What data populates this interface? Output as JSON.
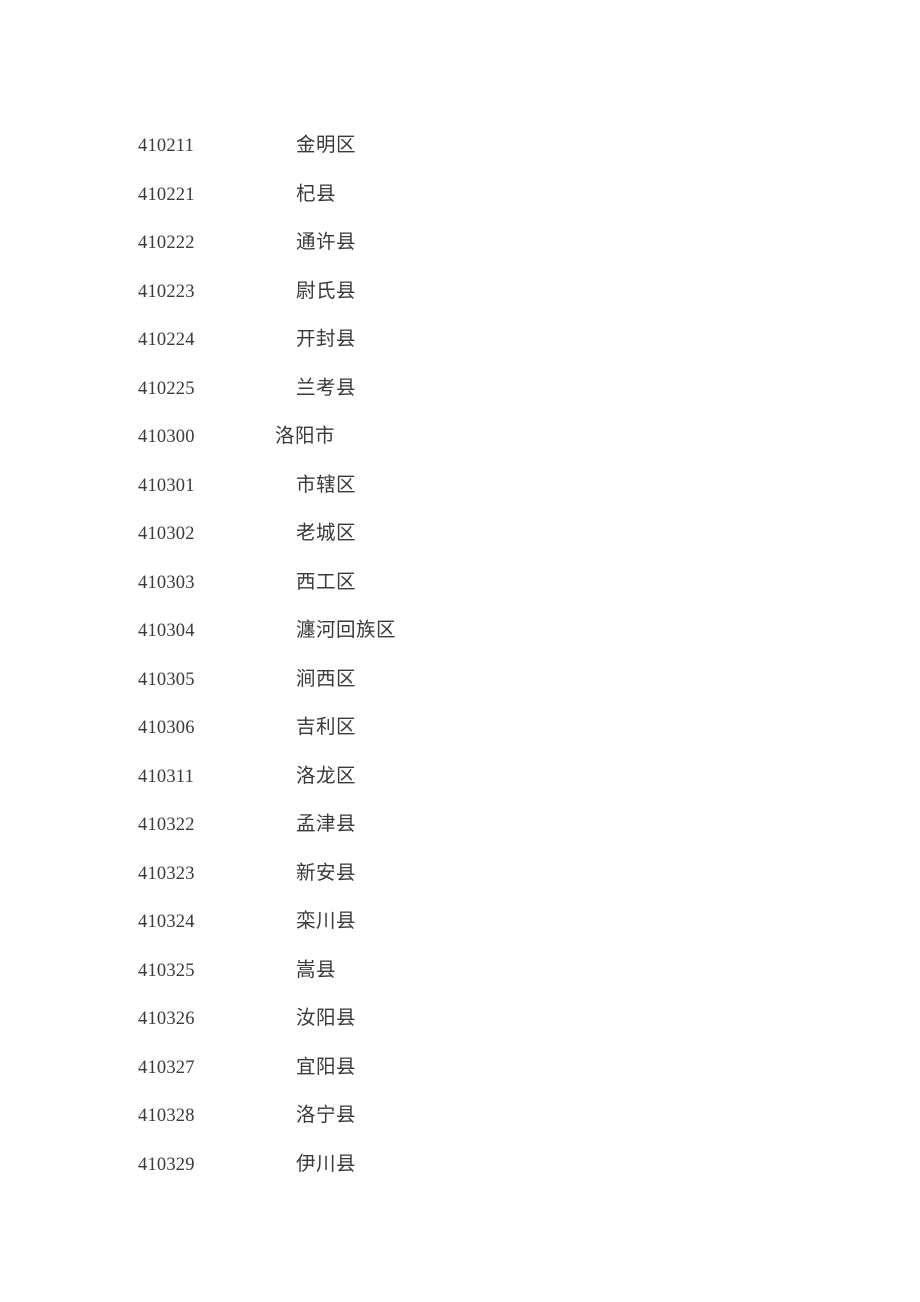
{
  "document": {
    "background_color": "#ffffff",
    "text_color": "#3a3a3a"
  },
  "code_list": {
    "rows": [
      {
        "code": "410211",
        "name": "金明区",
        "level": "county"
      },
      {
        "code": "410221",
        "name": "杞县",
        "level": "county"
      },
      {
        "code": "410222",
        "name": "通许县",
        "level": "county"
      },
      {
        "code": "410223",
        "name": "尉氏县",
        "level": "county"
      },
      {
        "code": "410224",
        "name": "开封县",
        "level": "county"
      },
      {
        "code": "410225",
        "name": "兰考县",
        "level": "county"
      },
      {
        "code": "410300",
        "name": "洛阳市",
        "level": "city"
      },
      {
        "code": "410301",
        "name": "市辖区",
        "level": "county"
      },
      {
        "code": "410302",
        "name": "老城区",
        "level": "county"
      },
      {
        "code": "410303",
        "name": "西工区",
        "level": "county"
      },
      {
        "code": "410304",
        "name": "瀍河回族区",
        "level": "county"
      },
      {
        "code": "410305",
        "name": "涧西区",
        "level": "county"
      },
      {
        "code": "410306",
        "name": "吉利区",
        "level": "county"
      },
      {
        "code": "410311",
        "name": "洛龙区",
        "level": "county"
      },
      {
        "code": "410322",
        "name": "孟津县",
        "level": "county"
      },
      {
        "code": "410323",
        "name": "新安县",
        "level": "county"
      },
      {
        "code": "410324",
        "name": "栾川县",
        "level": "county"
      },
      {
        "code": "410325",
        "name": "嵩县",
        "level": "county"
      },
      {
        "code": "410326",
        "name": "汝阳县",
        "level": "county"
      },
      {
        "code": "410327",
        "name": "宜阳县",
        "level": "county"
      },
      {
        "code": "410328",
        "name": "洛宁县",
        "level": "county"
      },
      {
        "code": "410329",
        "name": "伊川县",
        "level": "county"
      }
    ]
  }
}
